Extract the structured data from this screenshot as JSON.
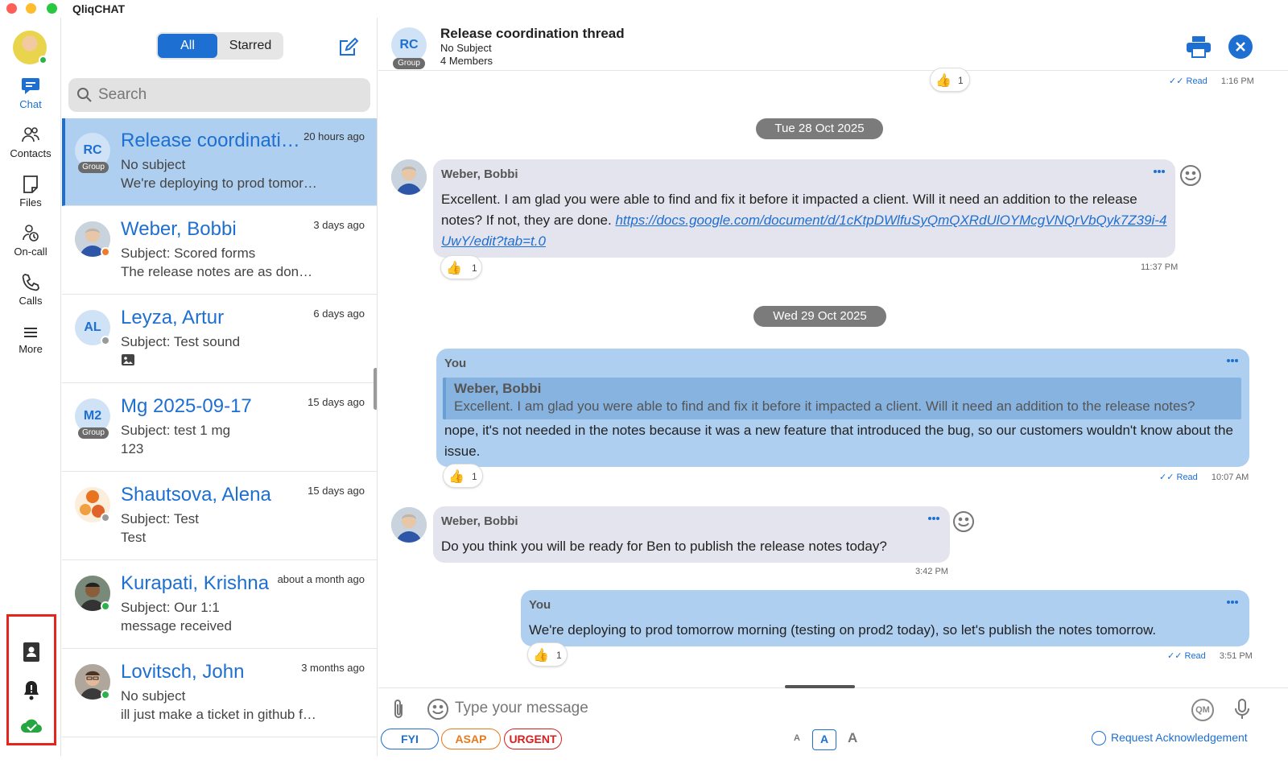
{
  "app": {
    "title": "QliqCHAT"
  },
  "rail": {
    "items": [
      {
        "label": "Chat",
        "icon": "chat-icon"
      },
      {
        "label": "Contacts",
        "icon": "contacts-icon"
      },
      {
        "label": "Files",
        "icon": "files-icon"
      },
      {
        "label": "On-call",
        "icon": "on-call-icon"
      },
      {
        "label": "Calls",
        "icon": "phone-icon"
      },
      {
        "label": "More",
        "icon": "menu-icon"
      }
    ],
    "bottom_icons": [
      "directory-icon",
      "bell-icon",
      "cloud-check-icon"
    ]
  },
  "list": {
    "tabs": {
      "all": "All",
      "starred": "Starred"
    },
    "search_placeholder": "Search",
    "conversations": [
      {
        "initials": "RC",
        "group_badge": "Group",
        "name": "Release coordination thread",
        "time": "20 hours ago",
        "line2": "No subject",
        "line3": "We're deploying to prod tomorrow morning"
      },
      {
        "initials": "",
        "name": "Weber, Bobbi",
        "time": "3 days ago",
        "line2": "Subject: Scored forms",
        "line3": "The release notes are as done as they can be"
      },
      {
        "initials": "AL",
        "name": "Leyza, Artur",
        "time": "6 days ago",
        "line2": "Subject: Test sound",
        "line3": ""
      },
      {
        "initials": "M2",
        "group_badge": "Group",
        "name": "Mg 2025-09-17",
        "time": "15 days ago",
        "line2": "Subject: test 1 mg",
        "line3": "123"
      },
      {
        "initials": "",
        "name": "Shautsova, Alena",
        "time": "15 days ago",
        "line2": "Subject: Test",
        "line3": "Test"
      },
      {
        "initials": "",
        "name": "Kurapati, Krishna",
        "time": "about a month ago",
        "line2": "Subject: Our 1:1",
        "line3": "message received"
      },
      {
        "initials": "",
        "name": "Lovitsch, John",
        "time": "3 months ago",
        "line2": "No subject",
        "line3": "ill just make a ticket in github for it"
      }
    ]
  },
  "chat": {
    "header": {
      "initials": "RC",
      "group_badge": "Group",
      "title": "Release coordination thread",
      "subject": "No Subject",
      "members": "4 Members"
    },
    "top_meta": {
      "read": "Read",
      "time": "1:16 PM",
      "reaction_count": "1"
    },
    "dates": [
      "Tue 28 Oct 2025",
      "Wed 29 Oct 2025"
    ],
    "messages": [
      {
        "sender": "Weber, Bobbi",
        "text": "Excellent. I am glad you were able to find and fix it before it impacted a client. Will it need an addition to the release notes?  If not, they are done.",
        "link": "https://docs.google.com/document/d/1cKtpDWlfuSyQmQXRdUlOYMcgVNQrVbQyk7Z39i-4UwY/edit?tab=t.0",
        "reaction_count": "1",
        "time": "11:37 PM"
      },
      {
        "sender": "You",
        "quote_sender": "Weber, Bobbi",
        "quote_text": "Excellent. I am glad you were able to find and fix it before it impacted a client. Will it need an addition to the release notes?",
        "text": "nope, it's not needed in the notes because it was a new feature that introduced the bug, so our customers wouldn't know about the issue.",
        "reaction_count": "1",
        "read": "Read",
        "time": "10:07 AM"
      },
      {
        "sender": "Weber, Bobbi",
        "text": "Do you think you will be ready for Ben to publish the release notes today?",
        "time": "3:42 PM"
      },
      {
        "sender": "You",
        "text": "We're deploying to prod tomorrow morning (testing on prod2 today), so let's publish the notes tomorrow.",
        "reaction_count": "1",
        "read": "Read",
        "time": "3:51 PM"
      }
    ],
    "composer": {
      "placeholder": "Type your message",
      "qm_label": "QM",
      "priorities": {
        "fyi": "FYI",
        "asap": "ASAP",
        "urgent": "URGENT"
      },
      "font_sizes": {
        "small": "A",
        "medium": "A",
        "large": "A"
      },
      "ack_label": "Request Acknowledgement"
    }
  },
  "colors": {
    "accent": "#1d6fd1",
    "selected_row": "#aecff0",
    "incoming_bubble": "#e4e4ee",
    "outgoing_bubble": "#aecff0",
    "highlight_box": "#e4251e",
    "online": "#2bb24c",
    "away": "#f07a2a",
    "offline": "#9a9a9a"
  }
}
